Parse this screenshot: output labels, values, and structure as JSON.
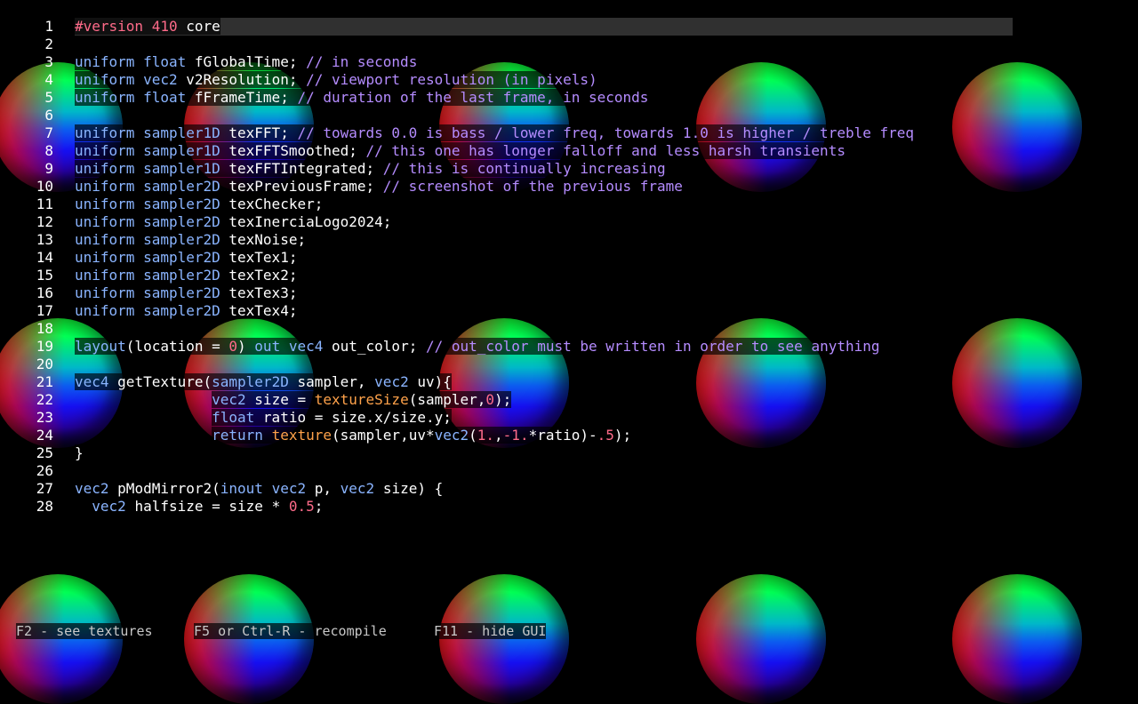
{
  "editor": {
    "lines": [
      {
        "n": "1",
        "indent": "",
        "tokens": [
          [
            "pp",
            "#version "
          ],
          [
            "num",
            "410"
          ],
          [
            "id",
            " core"
          ]
        ]
      },
      {
        "n": "2",
        "indent": "",
        "tokens": []
      },
      {
        "n": "3",
        "indent": "",
        "tokens": [
          [
            "kw",
            "uniform "
          ],
          [
            "ty",
            "float "
          ],
          [
            "id",
            "fGlobalTime; "
          ],
          [
            "cm",
            "// in seconds"
          ]
        ]
      },
      {
        "n": "4",
        "indent": "",
        "tokens": [
          [
            "kw",
            "uniform "
          ],
          [
            "ty",
            "vec2 "
          ],
          [
            "id",
            "v2Resolution; "
          ],
          [
            "cm",
            "// viewport resolution (in pixels)"
          ]
        ]
      },
      {
        "n": "5",
        "indent": "",
        "tokens": [
          [
            "kw",
            "uniform "
          ],
          [
            "ty",
            "float "
          ],
          [
            "id",
            "fFrameTime; "
          ],
          [
            "cm",
            "// duration of the last frame, in seconds"
          ]
        ]
      },
      {
        "n": "6",
        "indent": "",
        "tokens": []
      },
      {
        "n": "7",
        "indent": "",
        "tokens": [
          [
            "kw",
            "uniform "
          ],
          [
            "ty",
            "sampler1D "
          ],
          [
            "id",
            "texFFT; "
          ],
          [
            "cm",
            "// towards 0.0 is bass / lower freq, towards 1.0 is higher / treble freq"
          ]
        ]
      },
      {
        "n": "8",
        "indent": "",
        "tokens": [
          [
            "kw",
            "uniform "
          ],
          [
            "ty",
            "sampler1D "
          ],
          [
            "id",
            "texFFTSmoothed; "
          ],
          [
            "cm",
            "// this one has longer falloff and less harsh transients"
          ]
        ]
      },
      {
        "n": "9",
        "indent": "",
        "tokens": [
          [
            "kw",
            "uniform "
          ],
          [
            "ty",
            "sampler1D "
          ],
          [
            "id",
            "texFFTIntegrated; "
          ],
          [
            "cm",
            "// this is continually increasing"
          ]
        ]
      },
      {
        "n": "10",
        "indent": "",
        "tokens": [
          [
            "kw",
            "uniform "
          ],
          [
            "ty",
            "sampler2D "
          ],
          [
            "id",
            "texPreviousFrame; "
          ],
          [
            "cm",
            "// screenshot of the previous frame"
          ]
        ]
      },
      {
        "n": "11",
        "indent": "",
        "tokens": [
          [
            "kw",
            "uniform "
          ],
          [
            "ty",
            "sampler2D "
          ],
          [
            "id",
            "texChecker;"
          ]
        ]
      },
      {
        "n": "12",
        "indent": "",
        "tokens": [
          [
            "kw",
            "uniform "
          ],
          [
            "ty",
            "sampler2D "
          ],
          [
            "id",
            "texInerciaLogo2024;"
          ]
        ]
      },
      {
        "n": "13",
        "indent": "",
        "tokens": [
          [
            "kw",
            "uniform "
          ],
          [
            "ty",
            "sampler2D "
          ],
          [
            "id",
            "texNoise;"
          ]
        ]
      },
      {
        "n": "14",
        "indent": "",
        "tokens": [
          [
            "kw",
            "uniform "
          ],
          [
            "ty",
            "sampler2D "
          ],
          [
            "id",
            "texTex1;"
          ]
        ]
      },
      {
        "n": "15",
        "indent": "",
        "tokens": [
          [
            "kw",
            "uniform "
          ],
          [
            "ty",
            "sampler2D "
          ],
          [
            "id",
            "texTex2;"
          ]
        ]
      },
      {
        "n": "16",
        "indent": "",
        "tokens": [
          [
            "kw",
            "uniform "
          ],
          [
            "ty",
            "sampler2D "
          ],
          [
            "id",
            "texTex3;"
          ]
        ]
      },
      {
        "n": "17",
        "indent": "",
        "tokens": [
          [
            "kw",
            "uniform "
          ],
          [
            "ty",
            "sampler2D "
          ],
          [
            "id",
            "texTex4;"
          ]
        ]
      },
      {
        "n": "18",
        "indent": "",
        "tokens": []
      },
      {
        "n": "19",
        "indent": "",
        "tokens": [
          [
            "kw",
            "layout"
          ],
          [
            "id",
            "(location = "
          ],
          [
            "num",
            "0"
          ],
          [
            "id",
            ") "
          ],
          [
            "kw",
            "out "
          ],
          [
            "ty",
            "vec4 "
          ],
          [
            "id",
            "out_color; "
          ],
          [
            "cm",
            "// out_color must be written in order to see anything"
          ]
        ]
      },
      {
        "n": "20",
        "indent": "",
        "tokens": []
      },
      {
        "n": "21",
        "indent": "",
        "tokens": [
          [
            "ty",
            "vec4 "
          ],
          [
            "id",
            "getTexture("
          ],
          [
            "ty",
            "sampler2D "
          ],
          [
            "id",
            "sampler, "
          ],
          [
            "ty",
            "vec2 "
          ],
          [
            "id",
            "uv){"
          ]
        ]
      },
      {
        "n": "22",
        "indent": "                ",
        "tokens": [
          [
            "ty",
            "vec2 "
          ],
          [
            "id",
            "size = "
          ],
          [
            "fn",
            "textureSize"
          ],
          [
            "id",
            "(sampler,"
          ],
          [
            "num",
            "0"
          ],
          [
            "id",
            ");"
          ]
        ]
      },
      {
        "n": "23",
        "indent": "                ",
        "tokens": [
          [
            "ty",
            "float "
          ],
          [
            "id",
            "ratio = size.x/size.y;"
          ]
        ]
      },
      {
        "n": "24",
        "indent": "                ",
        "tokens": [
          [
            "kw",
            "return "
          ],
          [
            "fn",
            "texture"
          ],
          [
            "id",
            "(sampler,uv*"
          ],
          [
            "ty",
            "vec2"
          ],
          [
            "id",
            "("
          ],
          [
            "num",
            "1."
          ],
          [
            "id",
            ","
          ],
          [
            "num",
            "-1."
          ],
          [
            "id",
            "*ratio)-"
          ],
          [
            "num",
            ".5"
          ],
          [
            "id",
            ");"
          ]
        ]
      },
      {
        "n": "25",
        "indent": "",
        "tokens": [
          [
            "id",
            "}"
          ]
        ]
      },
      {
        "n": "26",
        "indent": "",
        "tokens": []
      },
      {
        "n": "27",
        "indent": "",
        "tokens": [
          [
            "ty",
            "vec2 "
          ],
          [
            "id",
            "pModMirror2("
          ],
          [
            "kw",
            "inout "
          ],
          [
            "ty",
            "vec2 "
          ],
          [
            "id",
            "p, "
          ],
          [
            "ty",
            "vec2 "
          ],
          [
            "id",
            "size) {"
          ]
        ]
      },
      {
        "n": "28",
        "indent": "  ",
        "tokens": [
          [
            "ty",
            "vec2 "
          ],
          [
            "id",
            "halfsize = size * "
          ],
          [
            "num",
            "0.5"
          ],
          [
            "id",
            ";"
          ]
        ]
      }
    ]
  },
  "status": {
    "textures": "F2 - see textures",
    "recompile": "F5 or Ctrl-R - recompile",
    "hide_gui": "F11 - hide GUI"
  },
  "colors": {
    "background": "#000000",
    "keyword": "#8ab4ff",
    "function": "#ffa24a",
    "number": "#ff6b8a",
    "comment": "#b58cff",
    "identifier": "#ffffff",
    "current_line": "#303030"
  },
  "background_pattern": {
    "type": "shaded-spheres",
    "rows": 3,
    "columns": 5
  }
}
